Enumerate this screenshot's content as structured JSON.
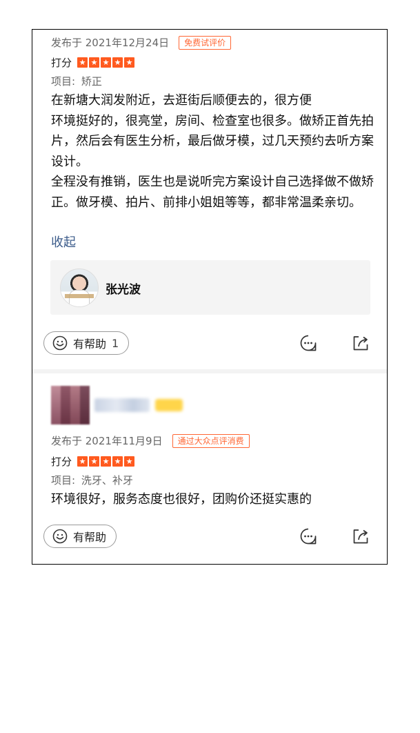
{
  "reviews": [
    {
      "date": "发布于 2021年12月24日",
      "tag": "免费试评价",
      "score_label": "打分",
      "stars": 5,
      "project_label": "项目:",
      "project_value": "矫正",
      "paragraphs": [
        "在新塘大润发附近，去逛街后顺便去的，很方便",
        "环境挺好的，很亮堂，房间、检查室也很多。做矫正首先拍片，然后会有医生分析，最后做牙模，过几天预约去听方案设计。",
        "全程没有推销，医生也是说听完方案设计自己选择做不做矫正。做牙模、拍片、前排小姐姐等等，都非常温柔亲切。"
      ],
      "collapse_label": "收起",
      "doctor": {
        "name": "张光波"
      },
      "helpful_label": "有帮助",
      "helpful_count": "1"
    },
    {
      "date": "发布于 2021年11月9日",
      "tag": "通过大众点评消费",
      "score_label": "打分",
      "stars": 5,
      "project_label": "项目:",
      "project_value": "洗牙、补牙",
      "text": "环境很好，服务态度也很好，团购价还挺实惠的",
      "helpful_label": "有帮助"
    }
  ],
  "icons": [
    "smile-icon",
    "comment-icon",
    "share-icon",
    "star-icon"
  ],
  "colors": {
    "accent": "#ff5a1f",
    "tag": "#ff6633",
    "link": "#3b5b8a"
  }
}
